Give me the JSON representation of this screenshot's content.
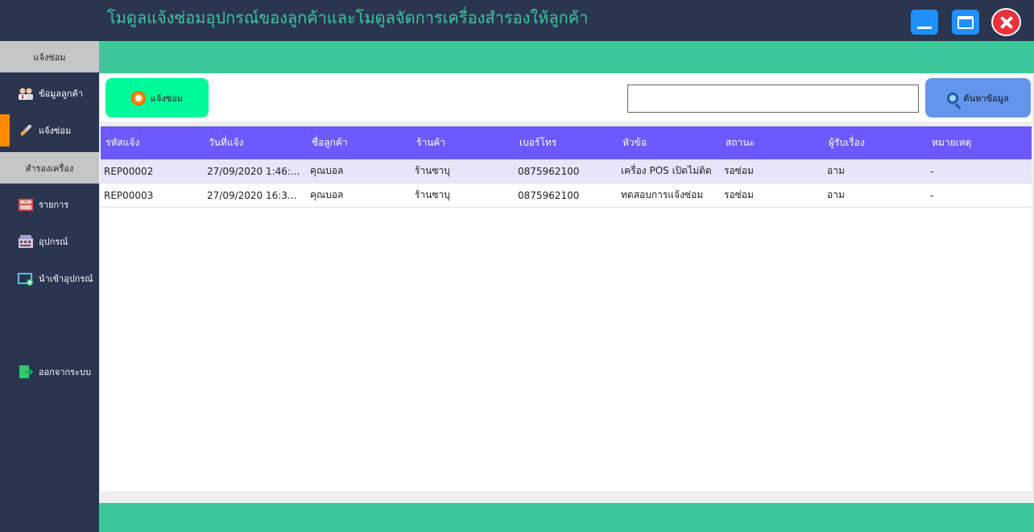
{
  "app": {
    "title": "โมดูลแจ้งซ่อมอุปกรณ์ของลูกค้าและโมดูลจัดการเครื่องสำรองให้ลูกค้า"
  },
  "sidebar": {
    "section_repair": "แจ้งซ่อม",
    "item_customer": "ข้อมูลลูกค้า",
    "item_report": "แจ้งซ่อม",
    "section_backup": "สำรองเครื่อง",
    "item_list": "รายการ",
    "item_device": "อุปกรณ์",
    "item_import": "นำเข้าอุปกรณ์",
    "item_logout": "ออกจากระบบ"
  },
  "toolbar": {
    "report_button": "แจ้งซ่อม",
    "search_value": "",
    "search_button": "ค้นหาข้อมูล"
  },
  "table": {
    "headers": [
      "รหัสแจ้ง",
      "วันที่แจ้ง",
      "ชื่อลูกค้า",
      "ร้านค้า",
      "เบอร์โทร",
      "หัวข้อ",
      "สถานะ",
      "ผู้รับเรื่อง",
      "หมายเหตุ"
    ],
    "rows": [
      [
        "REP00002",
        "27/09/2020 1:46:...",
        "คุณบอล",
        "ร้านซาบุ",
        "0875962100",
        "เครื่อง POS เปิดไม่ติด",
        "รอซ่อม",
        "อาม",
        "-"
      ],
      [
        "REP00003",
        "27/09/2020 16:3...",
        "คุณบอล",
        "ร้านซาบุ",
        "0875962100",
        "ทดสอบการแจ้งซ่อม",
        "รอซ่อม",
        "อาม",
        "-"
      ]
    ]
  }
}
